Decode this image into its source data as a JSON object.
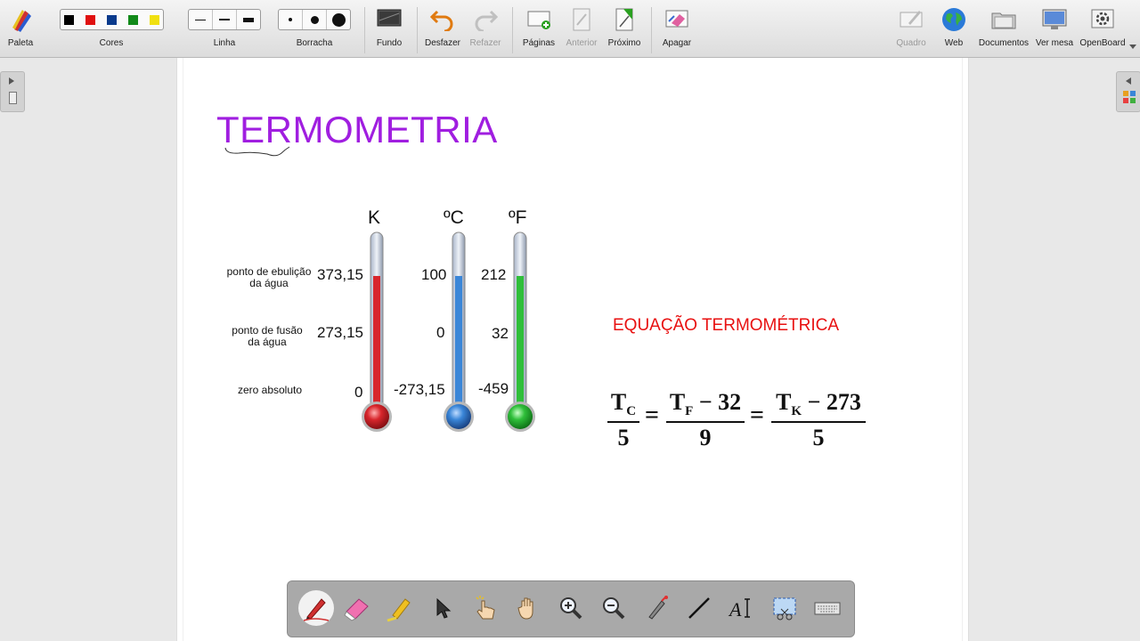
{
  "toolbar": {
    "palette_label": "Paleta",
    "colors_label": "Cores",
    "colors": [
      "#000000",
      "#e01010",
      "#0a3a8c",
      "#128a1a",
      "#f0e010"
    ],
    "line_label": "Linha",
    "eraser_label": "Borracha",
    "background_label": "Fundo",
    "undo_label": "Desfazer",
    "redo_label": "Refazer",
    "pages_label": "Páginas",
    "previous_label": "Anterior",
    "next_label": "Próximo",
    "clear_label": "Apagar",
    "board_label": "Quadro",
    "web_label": "Web",
    "documents_label": "Documentos",
    "desktop_label": "Ver mesa",
    "openboard_label": "OpenBoard"
  },
  "slide": {
    "title": "TERMOMETRIA",
    "units": {
      "kelvin": "K",
      "celsius": "ºC",
      "fahrenheit": "ºF"
    },
    "labels": {
      "boiling_1": "ponto de ebulição",
      "boiling_2": "da água",
      "melting_1": "ponto de fusão",
      "melting_2": "da água",
      "absolute_zero": "zero absoluto"
    },
    "kelvin_values": [
      "373,15",
      "273,15",
      "0"
    ],
    "celsius_values": [
      "100",
      "0",
      "-273,15"
    ],
    "fahrenheit_values": [
      "212",
      "32",
      "-459"
    ],
    "equation_title": "EQUAÇÃO TERMOMÉTRICA",
    "thermometer_colors": {
      "kelvin": "#d8262c",
      "celsius": "#3a86d8",
      "fahrenheit": "#2fbf3a"
    },
    "formula": {
      "tc": "T",
      "tc_sub": "C",
      "tc_den": "5",
      "tf": "T",
      "tf_sub": "F",
      "tf_rest": " − 32",
      "tf_den": "9",
      "tk": "T",
      "tk_sub": "K",
      "tk_rest": " − 273",
      "tk_den": "5",
      "equals": "="
    }
  }
}
